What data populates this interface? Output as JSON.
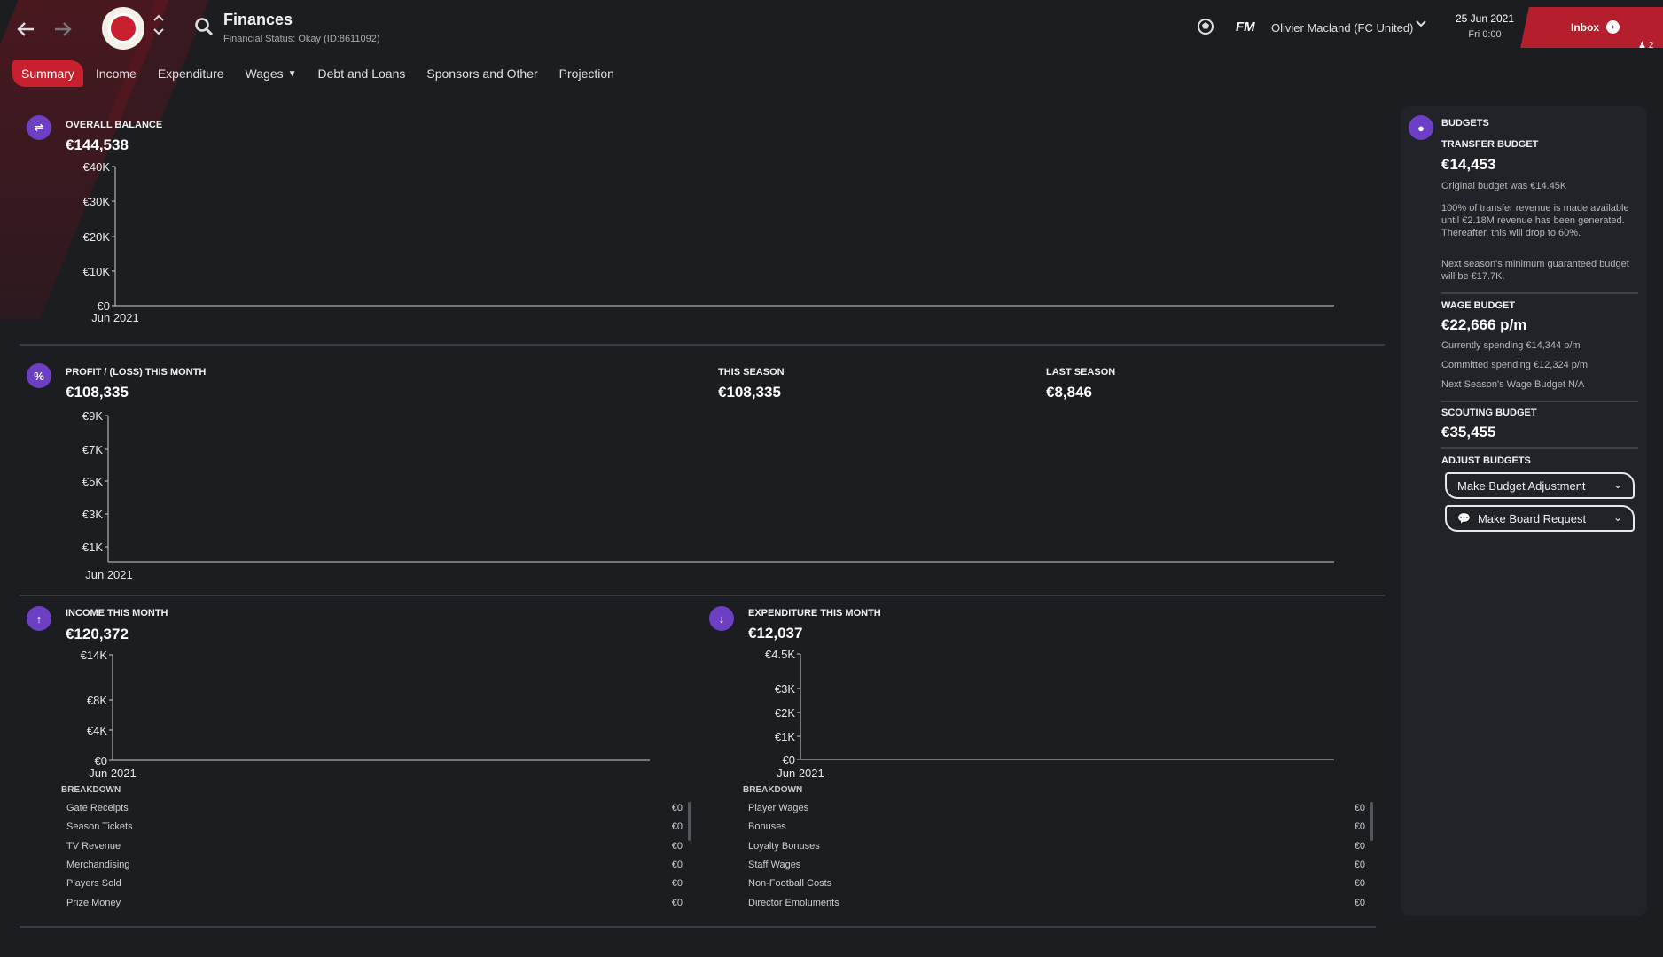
{
  "header": {
    "title": "Finances",
    "subtitle": "Financial Status: Okay (ID:8611092)",
    "manager": "Olivier Macland (FC United)",
    "date": "25 Jun 2021",
    "time": "Fri 0:00",
    "inbox_label": "Inbox",
    "inbox_count": "2",
    "fm_logo": "FM"
  },
  "tabs": [
    {
      "label": "Summary",
      "active": true
    },
    {
      "label": "Income"
    },
    {
      "label": "Expenditure"
    },
    {
      "label": "Wages",
      "dropdown": true
    },
    {
      "label": "Debt and Loans"
    },
    {
      "label": "Sponsors and Other"
    },
    {
      "label": "Projection"
    }
  ],
  "overall_balance": {
    "label": "OVERALL BALANCE",
    "value": "€144,538"
  },
  "profit": {
    "label": "PROFIT / (LOSS) THIS MONTH",
    "value": "€108,335",
    "this_season_label": "THIS SEASON",
    "this_season_value": "€108,335",
    "last_season_label": "LAST SEASON",
    "last_season_value": "€8,846"
  },
  "income": {
    "label": "INCOME THIS MONTH",
    "value": "€120,372",
    "breakdown_title": "BREAKDOWN",
    "breakdown": [
      {
        "name": "Gate Receipts",
        "value": "€0"
      },
      {
        "name": "Season Tickets",
        "value": "€0"
      },
      {
        "name": "TV Revenue",
        "value": "€0"
      },
      {
        "name": "Merchandising",
        "value": "€0"
      },
      {
        "name": "Players Sold",
        "value": "€0"
      },
      {
        "name": "Prize Money",
        "value": "€0"
      }
    ]
  },
  "expenditure": {
    "label": "EXPENDITURE THIS MONTH",
    "value": "€12,037",
    "breakdown_title": "BREAKDOWN",
    "breakdown": [
      {
        "name": "Player Wages",
        "value": "€0"
      },
      {
        "name": "Bonuses",
        "value": "€0"
      },
      {
        "name": "Loyalty Bonuses",
        "value": "€0"
      },
      {
        "name": "Staff Wages",
        "value": "€0"
      },
      {
        "name": "Non-Football Costs",
        "value": "€0"
      },
      {
        "name": "Director Emoluments",
        "value": "€0"
      }
    ]
  },
  "budgets": {
    "title": "BUDGETS",
    "transfer_label": "TRANSFER BUDGET",
    "transfer_value": "€14,453",
    "transfer_note1": "Original budget was €14.45K",
    "transfer_note2": "100% of transfer revenue is made available until €2.18M revenue has been generated. Thereafter, this will drop to 60%.",
    "transfer_note3": "Next season's minimum guaranteed budget will be €17.7K.",
    "wage_label": "WAGE BUDGET",
    "wage_value": "€22,666 p/m",
    "wage_note1": "Currently spending €14,344 p/m",
    "wage_note2": "Committed spending €12,324 p/m",
    "wage_note3": "Next Season's Wage Budget N/A",
    "scouting_label": "SCOUTING BUDGET",
    "scouting_value": "€35,455",
    "adjust_label": "ADJUST BUDGETS",
    "adjust_button": "Make Budget Adjustment",
    "board_button": "Make Board Request"
  },
  "chart_data": [
    {
      "type": "line",
      "categories": [
        "Jun 2021"
      ],
      "series": [],
      "yticks": [
        "€0",
        "€10K",
        "€20K",
        "€30K",
        "€40K"
      ],
      "ylim": [
        0,
        40000
      ]
    },
    {
      "type": "bar",
      "categories": [
        "Jun 2021"
      ],
      "series": [],
      "yticks": [
        "€1K",
        "€3K",
        "€5K",
        "€7K",
        "€9K"
      ],
      "ylim": [
        0,
        9000
      ]
    },
    {
      "type": "bar",
      "categories": [
        "Jun 2021"
      ],
      "series": [],
      "yticks": [
        "€0",
        "€4K",
        "€8K",
        "€14K"
      ],
      "ylim": [
        0,
        14000
      ]
    },
    {
      "type": "bar",
      "categories": [
        "Jun 2021"
      ],
      "series": [],
      "yticks": [
        "€0",
        "€1K",
        "€2K",
        "€3K",
        "€4.5K"
      ],
      "ylim": [
        0,
        4500
      ]
    }
  ],
  "colors": {
    "accent": "#c8202f",
    "section_icon": "#6d3fc4",
    "background": "#1c1d21"
  }
}
